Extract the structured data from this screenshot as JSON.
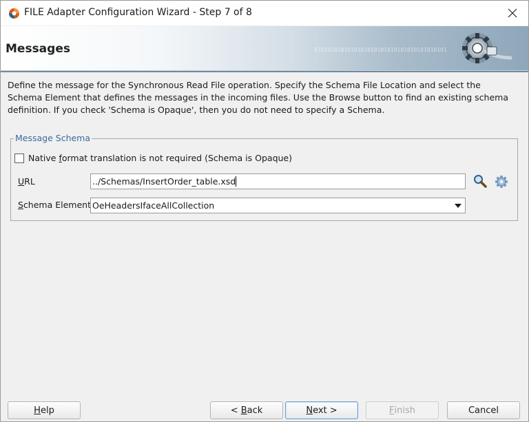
{
  "window": {
    "title": "FILE Adapter Configuration Wizard - Step 7 of 8"
  },
  "banner": {
    "title": "Messages",
    "binary_text": "0101010101010101010101010101010101010101"
  },
  "description": "Define the message for the Synchronous Read File operation.  Specify the Schema File Location and select the Schema Element that defines the messages in the incoming files. Use the Browse button to find an existing schema definition. If you check 'Schema is Opaque', then you do not need to specify a Schema.",
  "message_schema": {
    "legend": "Message Schema",
    "opaque_checkbox": {
      "label_pre": "Native ",
      "label_underline": "f",
      "label_post": "ormat translation is not required (Schema is Opaque)",
      "checked": false
    },
    "url": {
      "label_underline": "U",
      "label_rest": "RL",
      "value": "../Schemas/InsertOrder_table.xsd"
    },
    "schema_element": {
      "label_underline": "S",
      "label_rest": "chema Element",
      "value": "OeHeadersIfaceAllCollection"
    }
  },
  "buttons": {
    "help": {
      "underline": "H",
      "rest": "elp"
    },
    "back": {
      "pre": "< ",
      "underline": "B",
      "rest": "ack"
    },
    "next": {
      "underline": "N",
      "rest": "ext >"
    },
    "finish": {
      "underline": "F",
      "rest": "inish"
    },
    "cancel": "Cancel"
  },
  "colors": {
    "legend": "#3a6a9b",
    "banner_dark": "#8ea7ba"
  }
}
